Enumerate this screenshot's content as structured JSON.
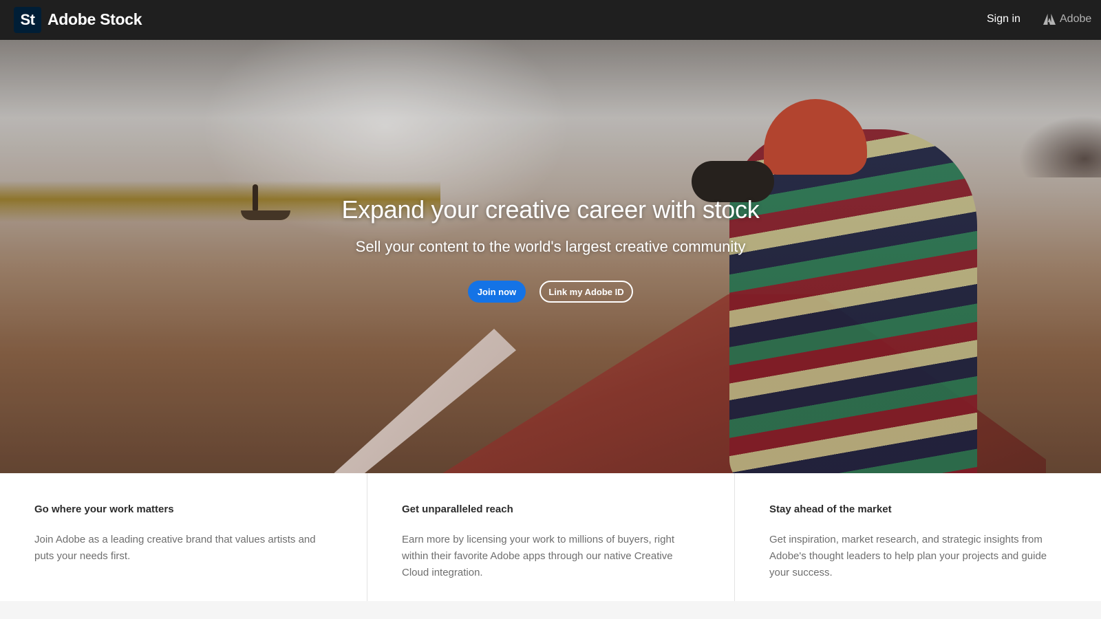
{
  "header": {
    "logo_text": "St",
    "brand": "Adobe Stock",
    "sign_in": "Sign in",
    "adobe": "Adobe"
  },
  "hero": {
    "title": "Expand your creative career with stock",
    "subtitle": "Sell your content to the world's largest creative community",
    "join_label": "Join now",
    "link_label": "Link my Adobe ID"
  },
  "features": [
    {
      "title": "Go where your work matters",
      "body": "Join Adobe as a leading creative brand that values artists and puts your needs first."
    },
    {
      "title": "Get unparalleled reach",
      "body": "Earn more by licensing your work to millions of buyers, right within their favorite Adobe apps through our native Creative Cloud integration."
    },
    {
      "title": "Stay ahead of the market",
      "body": "Get inspiration, market research, and strategic insights from Adobe's thought leaders to help plan your projects and guide your success."
    }
  ],
  "colors": {
    "header_bg": "#1f1f1f",
    "logo_bg": "#001e36",
    "primary_button": "#1473e6"
  },
  "icons": {
    "adobe": "adobe-logo-icon"
  }
}
